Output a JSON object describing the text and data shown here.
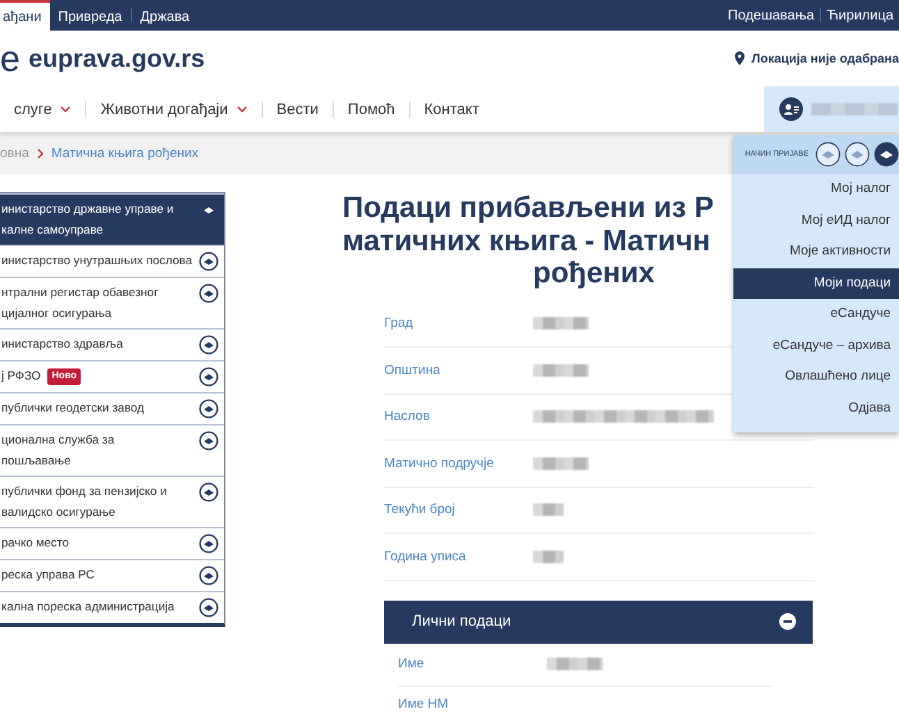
{
  "top_bar": {
    "tabs": [
      {
        "label": "ађани",
        "selected": true
      },
      {
        "label": "Привреда",
        "selected": false
      },
      {
        "label": "Држава",
        "selected": false
      }
    ],
    "links": [
      "Подешавања",
      "Ћирилица"
    ]
  },
  "header": {
    "logo_letter": "e",
    "site": "euprava.gov.rs",
    "location": "Локација није одабрана"
  },
  "nav": {
    "items": [
      {
        "label": "слуге",
        "dropdown": true
      },
      {
        "label": "Животни догађаји",
        "dropdown": true
      },
      {
        "label": "Вести",
        "dropdown": false
      },
      {
        "label": "Помоћ",
        "dropdown": false
      },
      {
        "label": "Контакт",
        "dropdown": false
      }
    ],
    "user_name_blurred": true
  },
  "breadcrumb": [
    "овна",
    "Матична књига рођених"
  ],
  "sidebar": {
    "items": [
      {
        "lines": [
          "инистарство државне управе и",
          "калне самоуправе"
        ],
        "selected": true
      },
      {
        "lines": [
          "инистарство унутрашњих послова"
        ],
        "selected": false
      },
      {
        "lines": [
          "нтрални регистар обавезног",
          "цијалног осигурања"
        ],
        "selected": false
      },
      {
        "lines": [
          "инистарство здравља"
        ],
        "selected": false
      },
      {
        "lines": [
          "ј РФЗО"
        ],
        "badge": "Ново",
        "selected": false
      },
      {
        "lines": [
          "публички геодетски завод"
        ],
        "selected": false
      },
      {
        "lines": [
          "ционална служба за",
          "пошљавање"
        ],
        "selected": false
      },
      {
        "lines": [
          "публички фонд за пензијско и",
          "валидско осигурање"
        ],
        "selected": false
      },
      {
        "lines": [
          "рачко место"
        ],
        "selected": false
      },
      {
        "lines": [
          "реска управа РС"
        ],
        "selected": false
      },
      {
        "lines": [
          "кална пореска администрација"
        ],
        "selected": false
      }
    ]
  },
  "main": {
    "title_lines": [
      "Подаци прибављени из Р",
      "матичних књига - Матичн",
      "рођених"
    ],
    "fields": [
      {
        "label": "Град",
        "kind": "medium",
        "blurred": true
      },
      {
        "label": "Општина",
        "kind": "medium",
        "blurred": true
      },
      {
        "label": "Наслов",
        "kind": "long",
        "blurred": true
      },
      {
        "label": "Матично подручје",
        "kind": "medium",
        "blurred": true
      },
      {
        "label": "Текући број",
        "kind": "short",
        "blurred": true
      },
      {
        "label": "Година уписа",
        "kind": "short",
        "blurred": true
      }
    ],
    "section": {
      "title": "Лични подаци",
      "expanded": true,
      "fields": [
        {
          "label": "Име",
          "kind": "medium",
          "blurred": true
        },
        {
          "label": "Име НМ",
          "kind": "medium",
          "blurred": false
        }
      ]
    }
  },
  "user_menu": {
    "login_method_label": "НАЧИН ПРИЈАВЕ",
    "login_methods": [
      {
        "selected": false
      },
      {
        "selected": false
      },
      {
        "selected": true
      }
    ],
    "items": [
      {
        "label": "Мој налог",
        "selected": false
      },
      {
        "label": "Мој еИД налог",
        "selected": false
      },
      {
        "label": "Моје активности",
        "selected": false
      },
      {
        "label": "Моји подаци",
        "selected": true
      },
      {
        "label": "еСандуче",
        "selected": false
      },
      {
        "label": "еСандуче – архива",
        "selected": false
      },
      {
        "label": "Овлашћено лице",
        "selected": false
      },
      {
        "label": "Одјава",
        "selected": false
      }
    ]
  }
}
